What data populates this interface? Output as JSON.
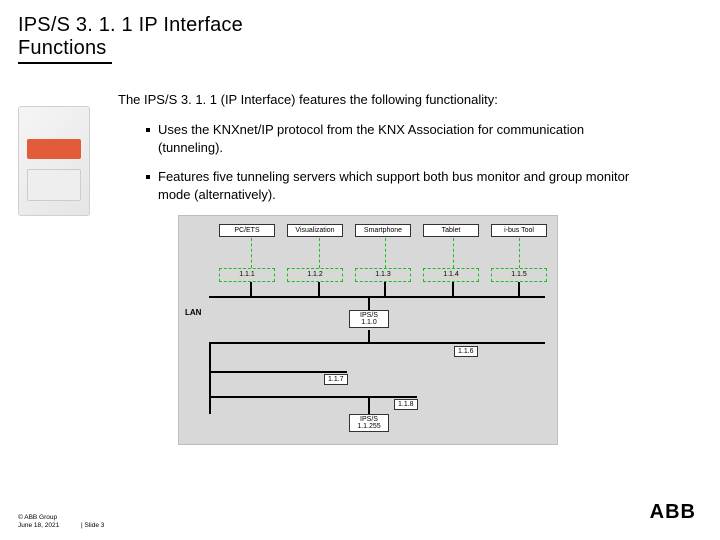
{
  "title": {
    "line1": "IPS/S 3. 1. 1 IP Interface",
    "line2": "Functions"
  },
  "intro": "The IPS/S 3. 1. 1 (IP Interface) features the following functionality:",
  "bullets": [
    "Uses the KNXnet/IP protocol from the KNX Association for communication (tunneling).",
    "Features five tunneling servers which support both bus monitor and group monitor mode (alternatively)."
  ],
  "diagram": {
    "devices": [
      "PC/ETS",
      "Visualization",
      "Smartphone",
      "Tablet",
      "i-bus Tool"
    ],
    "tunnels": [
      "1.1.1",
      "1.1.2",
      "1.1.3",
      "1.1.4",
      "1.1.5"
    ],
    "lan_label": "LAN",
    "ips": {
      "name": "IPS/S",
      "addr": "1.1.0"
    },
    "bus_addrs": [
      "1.1.6",
      "1.1.7",
      "1.1.8"
    ],
    "bottom_box": {
      "name": "IPS/S",
      "addr": "1.1.255"
    }
  },
  "footer": {
    "copyright": "© ABB Group",
    "date": "June 18, 2021",
    "slide": "| Slide 3"
  },
  "logo_text": "ABB"
}
